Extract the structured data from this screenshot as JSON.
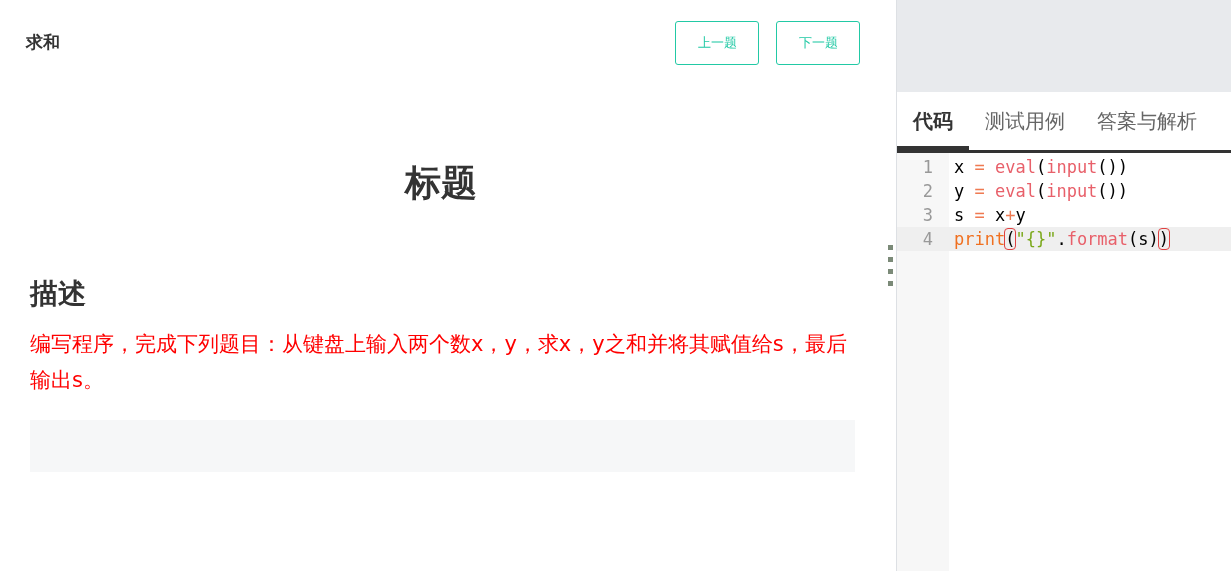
{
  "header": {
    "title": "求和",
    "buttons": [
      {
        "label": "上一题"
      },
      {
        "label": "下一题"
      }
    ]
  },
  "problem": {
    "heading": "标题",
    "section_title": "描述",
    "description": "编写程序，完成下列题目：从键盘上输入两个数x，y，求x，y之和并将其赋值给s，最后输出s。"
  },
  "tabs": [
    {
      "label": "代码",
      "selected": true
    },
    {
      "label": "测试用例",
      "selected": false
    },
    {
      "label": "答案与解析",
      "selected": false
    }
  ],
  "editor": {
    "lines": [
      {
        "number": "1",
        "active": false,
        "tokens": [
          {
            "text": "x",
            "kind": "plain"
          },
          {
            "text": " = ",
            "kind": "operator"
          },
          {
            "text": "eval",
            "kind": "builtin"
          },
          {
            "text": "(",
            "kind": "plain"
          },
          {
            "text": "input",
            "kind": "builtin"
          },
          {
            "text": "())",
            "kind": "plain"
          }
        ]
      },
      {
        "number": "2",
        "active": false,
        "tokens": [
          {
            "text": "y",
            "kind": "plain"
          },
          {
            "text": " = ",
            "kind": "operator"
          },
          {
            "text": "eval",
            "kind": "builtin"
          },
          {
            "text": "(",
            "kind": "plain"
          },
          {
            "text": "input",
            "kind": "builtin"
          },
          {
            "text": "())",
            "kind": "plain"
          }
        ]
      },
      {
        "number": "3",
        "active": false,
        "tokens": [
          {
            "text": "s",
            "kind": "plain"
          },
          {
            "text": " = ",
            "kind": "operator"
          },
          {
            "text": "x",
            "kind": "plain"
          },
          {
            "text": "+",
            "kind": "operator"
          },
          {
            "text": "y",
            "kind": "plain"
          }
        ]
      },
      {
        "number": "4",
        "active": true,
        "tokens": [
          {
            "text": "print",
            "kind": "keyword"
          },
          {
            "text": "(",
            "kind": "bracket"
          },
          {
            "text": "\"{}\"",
            "kind": "string"
          },
          {
            "text": ".",
            "kind": "plain"
          },
          {
            "text": "format",
            "kind": "builtin"
          },
          {
            "text": "(s)",
            "kind": "plain"
          },
          {
            "text": ")",
            "kind": "bracket"
          }
        ]
      }
    ]
  }
}
